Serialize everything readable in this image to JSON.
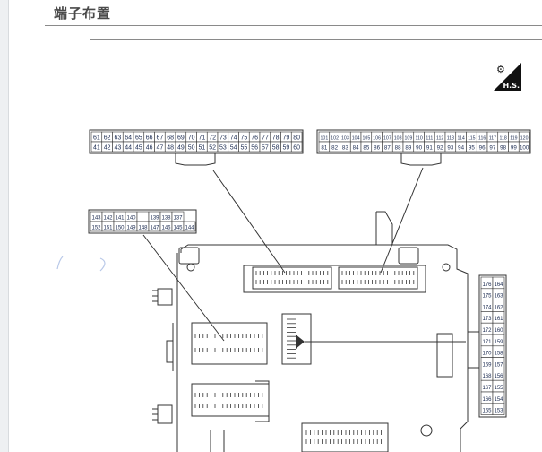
{
  "page": {
    "title": "端子布置"
  },
  "badge": {
    "label": "H.S.",
    "icon": "hs-service-icon"
  },
  "connectors": {
    "top_left": {
      "top_row": [
        "61",
        "62",
        "63",
        "64",
        "65",
        "66",
        "67",
        "68",
        "69",
        "70",
        "71",
        "72",
        "73",
        "74",
        "75",
        "76",
        "77",
        "78",
        "79",
        "80"
      ],
      "bottom_row": [
        "41",
        "42",
        "43",
        "44",
        "45",
        "46",
        "47",
        "48",
        "49",
        "50",
        "51",
        "52",
        "53",
        "54",
        "55",
        "56",
        "57",
        "58",
        "59",
        "60"
      ]
    },
    "top_right": {
      "top_row": [
        "101",
        "102",
        "103",
        "104",
        "105",
        "106",
        "107",
        "108",
        "109",
        "110",
        "111",
        "112",
        "113",
        "114",
        "115",
        "116",
        "117",
        "118",
        "119",
        "120"
      ],
      "bottom_row": [
        "81",
        "82",
        "83",
        "84",
        "85",
        "86",
        "87",
        "88",
        "89",
        "90",
        "91",
        "92",
        "93",
        "94",
        "95",
        "96",
        "97",
        "98",
        "99",
        "100"
      ]
    },
    "left_mid": {
      "top_row": [
        "143",
        "142",
        "141",
        "140",
        "",
        "139",
        "138",
        "137"
      ],
      "bottom_row": [
        "152",
        "151",
        "150",
        "149",
        "148",
        "147",
        "146",
        "145",
        "144"
      ]
    },
    "right_vertical": {
      "left_col": [
        "176",
        "175",
        "174",
        "173",
        "172",
        "171",
        "170",
        "169",
        "168",
        "167",
        "166",
        "165"
      ],
      "right_col": [
        "164",
        "163",
        "162",
        "161",
        "160",
        "159",
        "158",
        "157",
        "156",
        "155",
        "154",
        "153"
      ]
    }
  },
  "colors": {
    "pin_text": "#1a2a50",
    "line": "#333333",
    "accent": "#4a7fd4"
  }
}
